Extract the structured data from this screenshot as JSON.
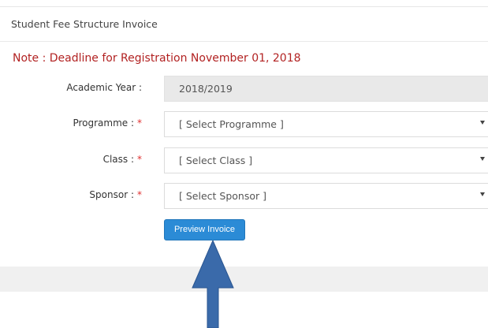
{
  "panel": {
    "title": "Student Fee Structure Invoice"
  },
  "note": "Note : Deadline for Registration November 01, 2018",
  "form": {
    "academic_year": {
      "label": "Academic Year :",
      "value": "2018/2019"
    },
    "programme": {
      "label": "Programme :",
      "required_mark": "*",
      "selected": "[ Select Programme ]"
    },
    "class": {
      "label": "Class :",
      "required_mark": "*",
      "selected": "[ Select Class ]"
    },
    "sponsor": {
      "label": "Sponsor :",
      "required_mark": "*",
      "selected": "[ Select Sponsor ]"
    },
    "preview_button": "Preview Invoice"
  },
  "colors": {
    "note": "#b22222",
    "required": "#e03030",
    "button": "#2b8bd6",
    "arrow": "#3a6aaa"
  }
}
